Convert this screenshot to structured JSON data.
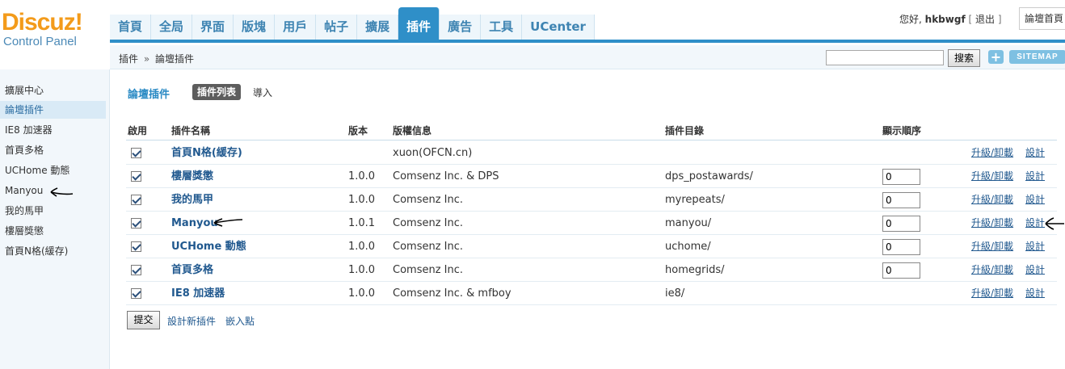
{
  "brand": {
    "logo_text": "Discuz!",
    "subtitle": "Control Panel"
  },
  "topnav": [
    {
      "label": "首頁",
      "active": false
    },
    {
      "label": "全局",
      "active": false
    },
    {
      "label": "界面",
      "active": false
    },
    {
      "label": "版塊",
      "active": false
    },
    {
      "label": "用戶",
      "active": false
    },
    {
      "label": "帖子",
      "active": false
    },
    {
      "label": "擴展",
      "active": false
    },
    {
      "label": "插件",
      "active": true
    },
    {
      "label": "廣告",
      "active": false
    },
    {
      "label": "工具",
      "active": false
    },
    {
      "label": "UCenter",
      "active": false
    }
  ],
  "user": {
    "greeting": "您好,",
    "name": "hkbwgf",
    "logout": "退出",
    "open_bracket": "[",
    "close_bracket": "]"
  },
  "top_select": {
    "value": "論壇首頁"
  },
  "breadcrumb": {
    "root": "插件",
    "sep": "»",
    "current": "論壇插件"
  },
  "search": {
    "value": "",
    "button": "搜索"
  },
  "actions": {
    "plus": "+",
    "sitemap": "SITEMAP"
  },
  "sidebar": {
    "items": [
      {
        "label": "擴展中心",
        "active": false
      },
      {
        "label": "論壇插件",
        "active": true
      },
      {
        "label": "IE8 加速器",
        "active": false
      },
      {
        "label": "首頁多格",
        "active": false
      },
      {
        "label": "UCHome 動態",
        "active": false
      },
      {
        "label": "Manyou",
        "active": false
      },
      {
        "label": "我的馬甲",
        "active": false
      },
      {
        "label": "樓層獎懲",
        "active": false
      },
      {
        "label": "首頁N格(緩存)",
        "active": false
      }
    ]
  },
  "main": {
    "title": "論壇插件",
    "tabs": {
      "list": "插件列表",
      "import": "導入"
    },
    "columns": {
      "enabled": "啟用",
      "name": "插件名稱",
      "version": "版本",
      "copyright": "版權信息",
      "directory": "插件目錄",
      "order": "顯示順序"
    },
    "rows": [
      {
        "enabled": true,
        "name": "首頁N格(緩存)",
        "version": "",
        "copyright": "xuon(OFCN.cn)",
        "directory": "",
        "order": "",
        "has_order": false,
        "link1": "升級/卸載",
        "link2": "設計"
      },
      {
        "enabled": true,
        "name": "樓層獎懲",
        "version": "1.0.0",
        "copyright": "Comsenz Inc. & DPS",
        "directory": "dps_postawards/",
        "order": "0",
        "has_order": true,
        "link1": "升級/卸載",
        "link2": "設計"
      },
      {
        "enabled": true,
        "name": "我的馬甲",
        "version": "1.0.0",
        "copyright": "Comsenz Inc.",
        "directory": "myrepeats/",
        "order": "0",
        "has_order": true,
        "link1": "升級/卸載",
        "link2": "設計"
      },
      {
        "enabled": true,
        "name": "Manyou",
        "version": "1.0.1",
        "copyright": "Comsenz Inc.",
        "directory": "manyou/",
        "order": "0",
        "has_order": true,
        "link1": "升級/卸載",
        "link2": "設計"
      },
      {
        "enabled": true,
        "name": "UCHome 動態",
        "version": "1.0.0",
        "copyright": "Comsenz Inc.",
        "directory": "uchome/",
        "order": "0",
        "has_order": true,
        "link1": "升級/卸載",
        "link2": "設計"
      },
      {
        "enabled": true,
        "name": "首頁多格",
        "version": "1.0.0",
        "copyright": "Comsenz Inc.",
        "directory": "homegrids/",
        "order": "0",
        "has_order": true,
        "link1": "升級/卸載",
        "link2": "設計"
      },
      {
        "enabled": true,
        "name": "IE8 加速器",
        "version": "1.0.0",
        "copyright": "Comsenz Inc. & mfboy",
        "directory": "ie8/",
        "order": "0",
        "has_order": true,
        "link1": "升級/卸載",
        "link2": "設計"
      }
    ],
    "footer": {
      "submit": "提交",
      "design_new": "設計新插件",
      "hooks": "嵌入點"
    }
  }
}
